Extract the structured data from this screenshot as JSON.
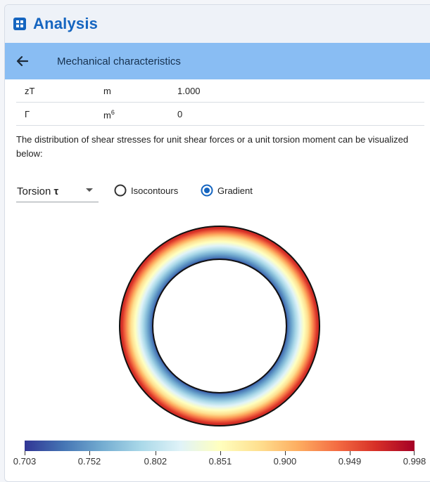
{
  "app": {
    "title": "Analysis",
    "icon": "calculator-icon"
  },
  "header": {
    "back_icon": "arrow-left-icon",
    "title": "Mechanical characteristics"
  },
  "properties": [
    {
      "name": "zT",
      "unit": "m",
      "value": "1.000"
    },
    {
      "name": "Γ",
      "unit_base": "m",
      "unit_exp": "6",
      "value": "0"
    }
  ],
  "description": "The distribution of shear stresses for unit shear forces or a unit torsion moment can be visualized below:",
  "controls": {
    "mode_select": {
      "value_prefix": "Torsion",
      "value_symbol": "τ"
    },
    "radio_isocontours": {
      "label": "Isocontours",
      "checked": false
    },
    "radio_gradient": {
      "label": "Gradient",
      "checked": true
    },
    "accent_color": "#1565c0"
  },
  "chart_data": {
    "type": "heatmap",
    "description_shape": "annular ring (circular tube cross-section)",
    "colormap": "RdYlBu_r",
    "value_inner": 0.703,
    "value_outer": 0.998,
    "colorbar": {
      "min": 0.703,
      "max": 0.998,
      "ticks": [
        "0.703",
        "0.752",
        "0.802",
        "0.851",
        "0.900",
        "0.949",
        "0.998"
      ]
    }
  }
}
